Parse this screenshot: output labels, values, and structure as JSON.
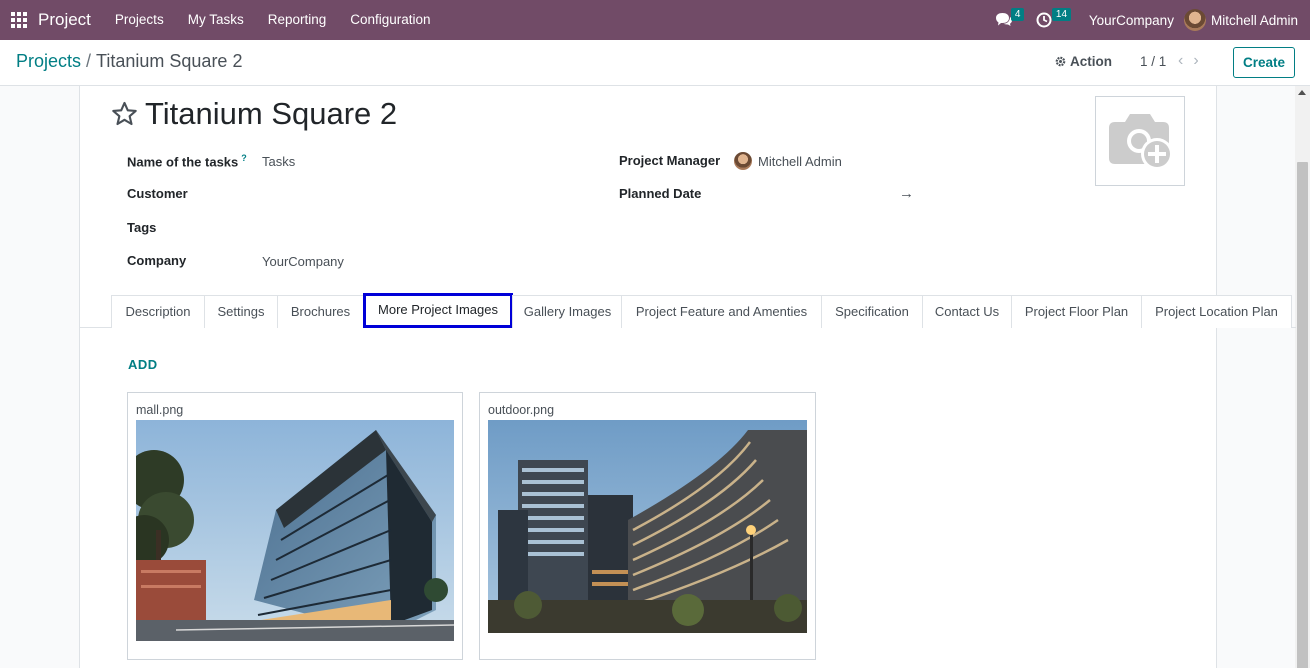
{
  "navbar": {
    "brand": "Project",
    "menu": [
      "Projects",
      "My Tasks",
      "Reporting",
      "Configuration"
    ],
    "messages_count": "4",
    "activities_count": "14",
    "company": "YourCompany",
    "user": "Mitchell Admin"
  },
  "control": {
    "breadcrumb_parent": "Projects",
    "breadcrumb_sep": "/",
    "breadcrumb_current": "Titanium Square 2",
    "action_label": "Action",
    "pager": "1 / 1",
    "create_label": "Create"
  },
  "form": {
    "title": "Titanium Square 2",
    "fields": {
      "name_of_tasks_label": "Name of the tasks",
      "name_of_tasks_help": "?",
      "name_of_tasks_value": "Tasks",
      "customer_label": "Customer",
      "tags_label": "Tags",
      "company_label": "Company",
      "company_value": "YourCompany",
      "project_manager_label": "Project Manager",
      "project_manager_value": "Mitchell Admin",
      "planned_date_label": "Planned Date",
      "planned_date_arrow": "→"
    }
  },
  "tabs": [
    {
      "label": "Description",
      "active": false
    },
    {
      "label": "Settings",
      "active": false
    },
    {
      "label": "Brochures",
      "active": false
    },
    {
      "label": "More Project Images",
      "active": true
    },
    {
      "label": "Gallery Images",
      "active": false
    },
    {
      "label": "Project Feature and Amenties",
      "active": false
    },
    {
      "label": "Specification",
      "active": false
    },
    {
      "label": "Contact Us",
      "active": false
    },
    {
      "label": "Project Floor Plan",
      "active": false
    },
    {
      "label": "Project Location Plan",
      "active": false
    }
  ],
  "images_tab": {
    "add_label": "ADD",
    "images": [
      {
        "name": "mall.png"
      },
      {
        "name": "outdoor.png"
      }
    ]
  },
  "colors": {
    "navbar": "#714b67",
    "accent": "#017e84",
    "active_tab_outline": "#0000d8"
  }
}
